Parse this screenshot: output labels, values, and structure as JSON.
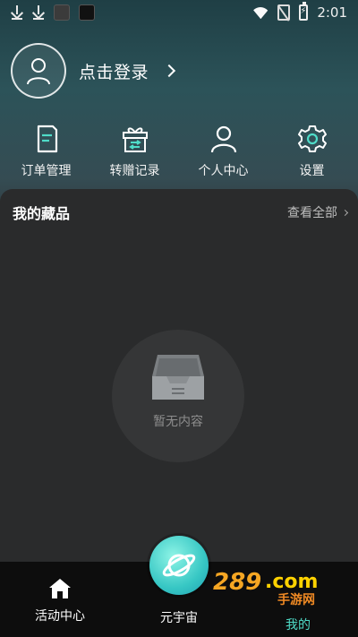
{
  "status_bar": {
    "time": "2:01",
    "icons": [
      "download-icon",
      "download-icon",
      "app-icon",
      "app-icon",
      "wifi-icon",
      "no-sim-icon",
      "battery-charging-icon"
    ]
  },
  "profile": {
    "login_label": "点击登录",
    "icon": "user-icon"
  },
  "shortcuts": [
    {
      "label": "订单管理",
      "icon": "document-icon"
    },
    {
      "label": "转赠记录",
      "icon": "gift-icon"
    },
    {
      "label": "个人中心",
      "icon": "user-icon"
    },
    {
      "label": "设置",
      "icon": "gear-icon"
    }
  ],
  "collection": {
    "title": "我的藏品",
    "view_all": "查看全部",
    "empty_text": "暂无内容",
    "empty_icon": "inbox-tray-icon"
  },
  "bottom_nav": [
    {
      "label": "活动中心",
      "icon": "home-icon"
    },
    {
      "label": "元宇宙",
      "icon": "planet-icon"
    },
    {
      "label": "我的",
      "icon": "user-icon",
      "active": true
    }
  ],
  "watermark": {
    "text_main": "289.com",
    "text_sub": "手游网"
  },
  "colors": {
    "accent": "#4fdcc8",
    "card_bg": "#2a2b2c",
    "nav_bg": "#0d0d0d"
  }
}
